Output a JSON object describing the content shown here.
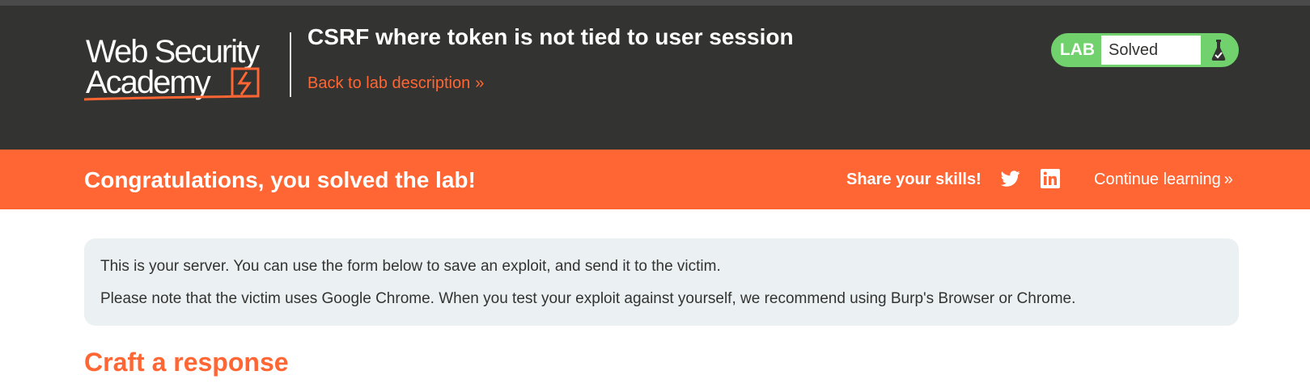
{
  "header": {
    "logo": {
      "line1": "Web Security",
      "line2": "Academy"
    },
    "lab_title": "CSRF where token is not tied to user session",
    "back_link": "Back to lab description",
    "back_chevron": "»",
    "status": {
      "badge": "LAB",
      "text": "Solved",
      "icon": "flask-icon"
    }
  },
  "banner": {
    "message": "Congratulations, you solved the lab!",
    "share_label": "Share your skills!",
    "share_icons": [
      "twitter-icon",
      "linkedin-icon"
    ],
    "continue_label": "Continue learning",
    "continue_chevron": "»"
  },
  "server_info": {
    "line1": "This is your server. You can use the form below to save an exploit, and send it to the victim.",
    "line2": "Please note that the victim uses Google Chrome. When you test your exploit against yourself, we recommend using Burp's Browser or Chrome."
  },
  "section": {
    "heading": "Craft a response"
  },
  "colors": {
    "header_bg": "#333332",
    "accent_orange": "#ff6633",
    "solved_green": "#70d16d",
    "info_bg": "#ebf0f2",
    "text_dark": "#333332"
  }
}
